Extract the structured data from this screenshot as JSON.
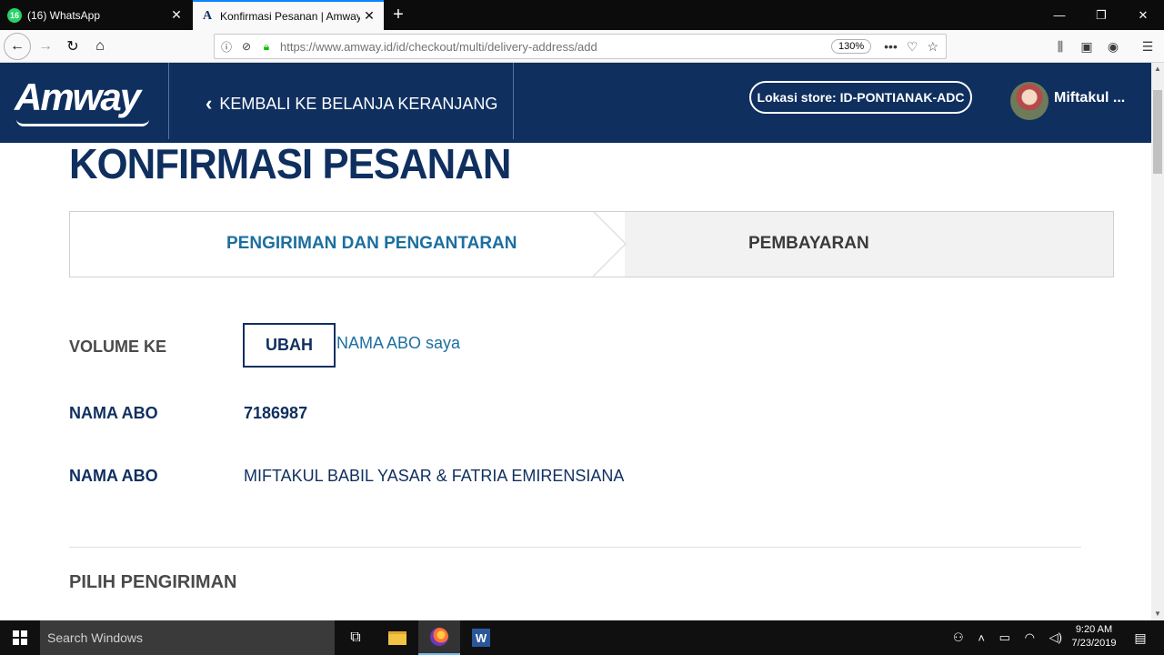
{
  "browser": {
    "tabs": [
      {
        "title": "(16) WhatsApp",
        "favicon": "whatsapp-icon",
        "favicon_text": "16"
      },
      {
        "title": "Konfirmasi Pesanan | Amway Ir",
        "favicon": "amway-icon",
        "favicon_text": "A"
      }
    ],
    "close_glyph": "✕",
    "new_tab_glyph": "+",
    "url": "https://www.amway.id/id/checkout/multi/delivery-address/add",
    "zoom": "130%",
    "window_controls": {
      "minimize": "—",
      "restore": "❐",
      "close": "✕"
    }
  },
  "header": {
    "logo": "Amway",
    "back_link": "KEMBALI KE BELANJA KERANJANG",
    "store": "Lokasi store: ID-PONTIANAK-ADC",
    "user": "Miftakul ..."
  },
  "page": {
    "title": "KONFIRMASI PESANAN",
    "steps": [
      {
        "label": "PENGIRIMAN DAN PENGANTARAN",
        "active": true
      },
      {
        "label": "PEMBAYARAN",
        "active": false
      }
    ],
    "volume_label": "VOLUME KE",
    "ubah_button": "UBAH",
    "abo_link": "NAMA ABO saya",
    "rows": [
      {
        "label": "NAMA ABO",
        "value": "7186987"
      },
      {
        "label": "NAMA ABO",
        "value": "MIFTAKUL BABIL YASAR & FATRIA EMIRENSIANA"
      }
    ],
    "section_title": "PILIH PENGIRIMAN"
  },
  "taskbar": {
    "search_placeholder": "Search Windows",
    "time": "9:20 AM",
    "date": "7/23/2019"
  },
  "colors": {
    "brand_navy": "#0f2f5f",
    "link_blue": "#1c6fa0",
    "step_inactive_bg": "#f2f2f2"
  }
}
